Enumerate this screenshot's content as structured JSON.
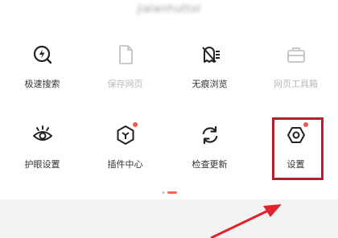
{
  "header": {
    "username_blurred": "jialanhuttol"
  },
  "grid": {
    "items": [
      {
        "label": "极速搜索",
        "icon": "fast-search-icon",
        "disabled": false,
        "badge": false
      },
      {
        "label": "保存网页",
        "icon": "save-page-icon",
        "disabled": true,
        "badge": false
      },
      {
        "label": "无痕浏览",
        "icon": "incognito-icon",
        "disabled": false,
        "badge": false
      },
      {
        "label": "网页工具箱",
        "icon": "toolbox-icon",
        "disabled": true,
        "badge": false
      },
      {
        "label": "护眼设置",
        "icon": "eye-icon",
        "disabled": false,
        "badge": false
      },
      {
        "label": "插件中心",
        "icon": "plugin-icon",
        "disabled": false,
        "badge": true
      },
      {
        "label": "检查更新",
        "icon": "refresh-icon",
        "disabled": false,
        "badge": false
      },
      {
        "label": "设置",
        "icon": "settings-icon",
        "disabled": false,
        "badge": true
      }
    ]
  },
  "colors": {
    "badge": "#f05a4a",
    "highlight": "#b3202a",
    "arrow": "#e0242b",
    "pager_active": "#ef6a50"
  }
}
